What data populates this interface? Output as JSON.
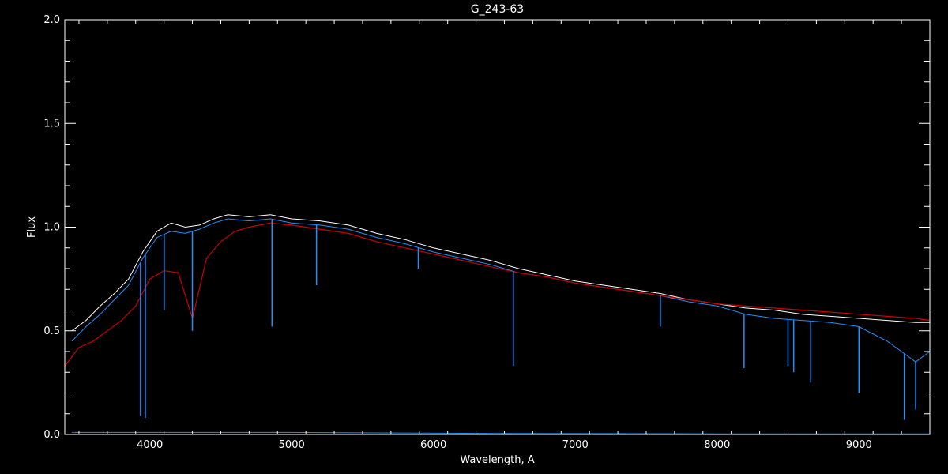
{
  "chart_data": {
    "type": "line",
    "title": "G_243-63",
    "xlabel": "Wavelength, A",
    "ylabel": "Flux",
    "xlim": [
      3400,
      9500
    ],
    "ylim": [
      0,
      2.0
    ],
    "x_ticks": [
      4000,
      5000,
      6000,
      7000,
      8000,
      9000
    ],
    "x_tick_labels": [
      "4000",
      "5000",
      "6000",
      "7000",
      "8000",
      "9000"
    ],
    "y_ticks": [
      0,
      0.5,
      1.0,
      1.5,
      2.0
    ],
    "y_tick_labels": [
      "0.0",
      "0.5",
      "1.0",
      "1.5",
      "2.0"
    ],
    "grid": false,
    "colors": {
      "background": "#000000",
      "axes": "#ffffff",
      "observed": "#ffffff",
      "observed_fine": "#1e90ff",
      "model": "#cc0000"
    },
    "series": [
      {
        "color": "#ffffff",
        "x": [
          3450,
          3550,
          3650,
          3750,
          3850,
          3950,
          4050,
          4150,
          4250,
          4350,
          4450,
          4550,
          4700,
          4850,
          5000,
          5200,
          5400,
          5600,
          5800,
          6000,
          6200,
          6400,
          6600,
          6800,
          7000,
          7200,
          7400,
          7600,
          7800,
          8000,
          8200,
          8400,
          8600,
          8800,
          9000,
          9200,
          9400,
          9500
        ],
        "values": [
          0.5,
          0.55,
          0.62,
          0.68,
          0.75,
          0.88,
          0.98,
          1.02,
          1.0,
          1.01,
          1.04,
          1.06,
          1.05,
          1.06,
          1.04,
          1.03,
          1.01,
          0.97,
          0.94,
          0.9,
          0.87,
          0.84,
          0.8,
          0.77,
          0.74,
          0.72,
          0.7,
          0.68,
          0.65,
          0.63,
          0.61,
          0.6,
          0.58,
          0.57,
          0.56,
          0.55,
          0.54,
          0.54
        ]
      },
      {
        "color": "#1e90ff",
        "x": [
          3450,
          3550,
          3650,
          3750,
          3850,
          3950,
          4050,
          4150,
          4250,
          4350,
          4450,
          4550,
          4700,
          4850,
          5000,
          5200,
          5400,
          5600,
          5800,
          6000,
          6200,
          6400,
          6600,
          6800,
          7000,
          7200,
          7400,
          7600,
          7800,
          8000,
          8200,
          8400,
          8600,
          8800,
          9000,
          9200,
          9400,
          9500
        ],
        "values": [
          0.45,
          0.52,
          0.58,
          0.65,
          0.72,
          0.85,
          0.95,
          0.98,
          0.97,
          0.99,
          1.02,
          1.04,
          1.03,
          1.04,
          1.02,
          1.01,
          0.99,
          0.95,
          0.92,
          0.88,
          0.85,
          0.82,
          0.78,
          0.76,
          0.73,
          0.71,
          0.69,
          0.67,
          0.64,
          0.62,
          0.58,
          0.56,
          0.55,
          0.54,
          0.52,
          0.45,
          0.35,
          0.4
        ]
      },
      {
        "color": "#cc0000",
        "x": [
          3400,
          3500,
          3600,
          3700,
          3800,
          3900,
          4000,
          4100,
          4200,
          4300,
          4400,
          4500,
          4600,
          4700,
          4850,
          5000,
          5200,
          5400,
          5600,
          5800,
          6000,
          6200,
          6400,
          6600,
          6800,
          7000,
          7200,
          7400,
          7600,
          7800,
          8000,
          8200,
          8400,
          8600,
          8800,
          9000,
          9200,
          9400,
          9500
        ],
        "values": [
          0.33,
          0.42,
          0.45,
          0.5,
          0.55,
          0.62,
          0.75,
          0.79,
          0.78,
          0.56,
          0.85,
          0.93,
          0.98,
          1.0,
          1.02,
          1.01,
          0.99,
          0.97,
          0.93,
          0.9,
          0.87,
          0.84,
          0.81,
          0.78,
          0.76,
          0.73,
          0.71,
          0.69,
          0.67,
          0.65,
          0.63,
          0.62,
          0.61,
          0.6,
          0.59,
          0.58,
          0.57,
          0.56,
          0.55
        ]
      },
      {
        "color": "#1e90ff",
        "x": [
          3450,
          5000,
          6500,
          7600,
          8000,
          9500
        ],
        "values": [
          0.01,
          0.01,
          0.005,
          0.004,
          0.003,
          0.003
        ]
      }
    ],
    "absorption_lines": [
      {
        "x": 3934,
        "depth_to": 0.09,
        "color": "#1e90ff"
      },
      {
        "x": 3968,
        "depth_to": 0.08,
        "color": "#1e90ff"
      },
      {
        "x": 4101,
        "depth_to": 0.6,
        "color": "#1e90ff"
      },
      {
        "x": 4300,
        "depth_to": 0.5,
        "color": "#1e90ff"
      },
      {
        "x": 4861,
        "depth_to": 0.52,
        "color": "#1e90ff"
      },
      {
        "x": 5175,
        "depth_to": 0.72,
        "color": "#1e90ff"
      },
      {
        "x": 5893,
        "depth_to": 0.8,
        "color": "#1e90ff"
      },
      {
        "x": 6563,
        "depth_to": 0.33,
        "color": "#1e90ff"
      },
      {
        "x": 7600,
        "depth_to": 0.52,
        "color": "#1e90ff"
      },
      {
        "x": 8190,
        "depth_to": 0.32,
        "color": "#1e90ff"
      },
      {
        "x": 8500,
        "depth_to": 0.33,
        "color": "#1e90ff"
      },
      {
        "x": 8540,
        "depth_to": 0.3,
        "color": "#1e90ff"
      },
      {
        "x": 8660,
        "depth_to": 0.25,
        "color": "#1e90ff"
      },
      {
        "x": 9000,
        "depth_to": 0.2,
        "color": "#1e90ff"
      },
      {
        "x": 9320,
        "depth_to": 0.07,
        "color": "#1e90ff"
      },
      {
        "x": 9400,
        "depth_to": 0.12,
        "color": "#1e90ff"
      }
    ]
  }
}
